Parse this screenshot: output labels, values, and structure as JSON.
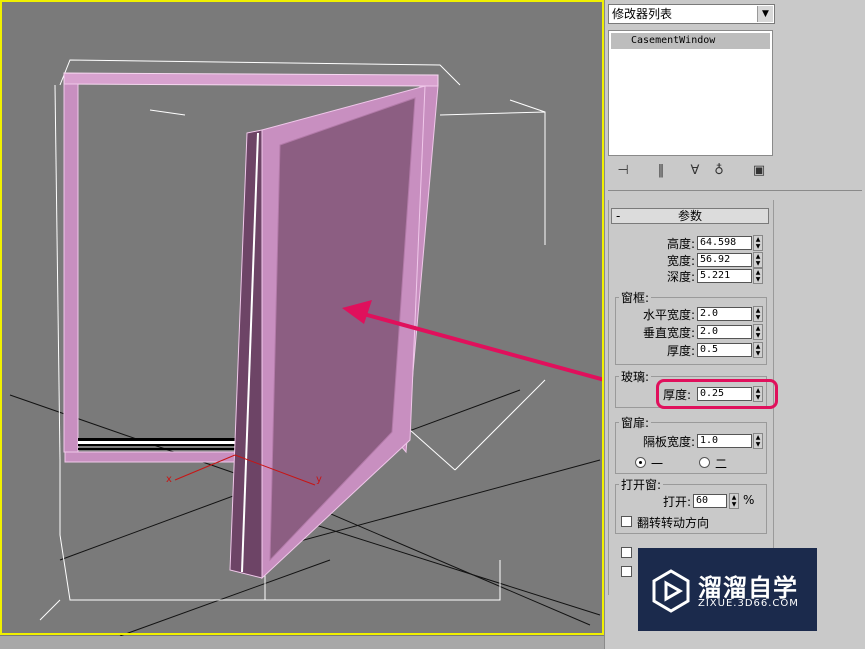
{
  "panel": {
    "modifier_list": "修改器列表",
    "stack_item": "CasementWindow",
    "rollout_title": "参数",
    "rollout_minus": "-",
    "height_label": "高度:",
    "height_value": "64.598",
    "width_label": "宽度:",
    "width_value": "56.92",
    "depth_label": "深度:",
    "depth_value": "5.221",
    "frame_group": "窗框:",
    "h_width_label": "水平宽度:",
    "h_width_value": "2.0",
    "v_width_label": "垂直宽度:",
    "v_width_value": "2.0",
    "frame_thick_label": "厚度:",
    "frame_thick_value": "0.5",
    "glass_group": "玻璃:",
    "glass_thick_label": "厚度:",
    "glass_thick_value": "0.25",
    "casement_group": "窗扉:",
    "panel_width_label": "隔板宽度:",
    "panel_width_value": "1.0",
    "radio_one": "一",
    "radio_two": "二",
    "open_group": "打开窗:",
    "open_label": "打开:",
    "open_value": "60",
    "open_unit": "%",
    "flip_label": "翻转转动方向"
  },
  "viewport": {
    "axis_x": "x",
    "axis_y": "y"
  },
  "watermark": {
    "title": "溜溜自学",
    "url": "ZIXUE.3D66.COM"
  },
  "colors": {
    "viewport_bg": "#7a7a7a",
    "window_pink": "#c88fc0",
    "pane_fill": "#8c5e82",
    "arrow": "#e0105c",
    "active_border": "#f0f000"
  }
}
